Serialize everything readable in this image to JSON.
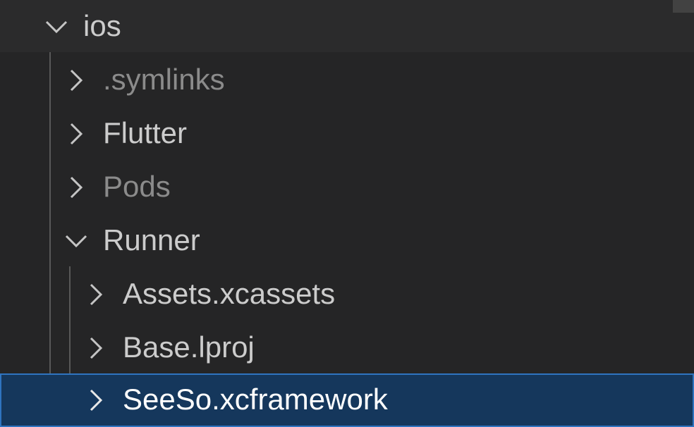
{
  "tree": {
    "root": {
      "label": "ios",
      "expanded": true,
      "twisty_icon": "chevron-down-icon"
    },
    "items": [
      {
        "label": ".symlinks",
        "expanded": false,
        "dim": true,
        "twisty_icon": "chevron-right-icon"
      },
      {
        "label": "Flutter",
        "expanded": false,
        "dim": false,
        "twisty_icon": "chevron-right-icon"
      },
      {
        "label": "Pods",
        "expanded": false,
        "dim": true,
        "twisty_icon": "chevron-right-icon"
      },
      {
        "label": "Runner",
        "expanded": true,
        "dim": false,
        "twisty_icon": "chevron-down-icon"
      }
    ],
    "runner_children": [
      {
        "label": "Assets.xcassets",
        "expanded": false,
        "twisty_icon": "chevron-right-icon"
      },
      {
        "label": "Base.lproj",
        "expanded": false,
        "twisty_icon": "chevron-right-icon"
      },
      {
        "label": "SeeSo.xcframework",
        "expanded": false,
        "selected": true,
        "twisty_icon": "chevron-right-icon"
      }
    ]
  },
  "colors": {
    "background": "#252526",
    "sticky_background": "#2b2b2c",
    "selected_background": "#15375c",
    "selected_border": "#2f74c0",
    "text": "#cccccc",
    "text_dim": "#8b8b8b",
    "text_selected": "#ffffff",
    "indent_guide": "#585858"
  }
}
